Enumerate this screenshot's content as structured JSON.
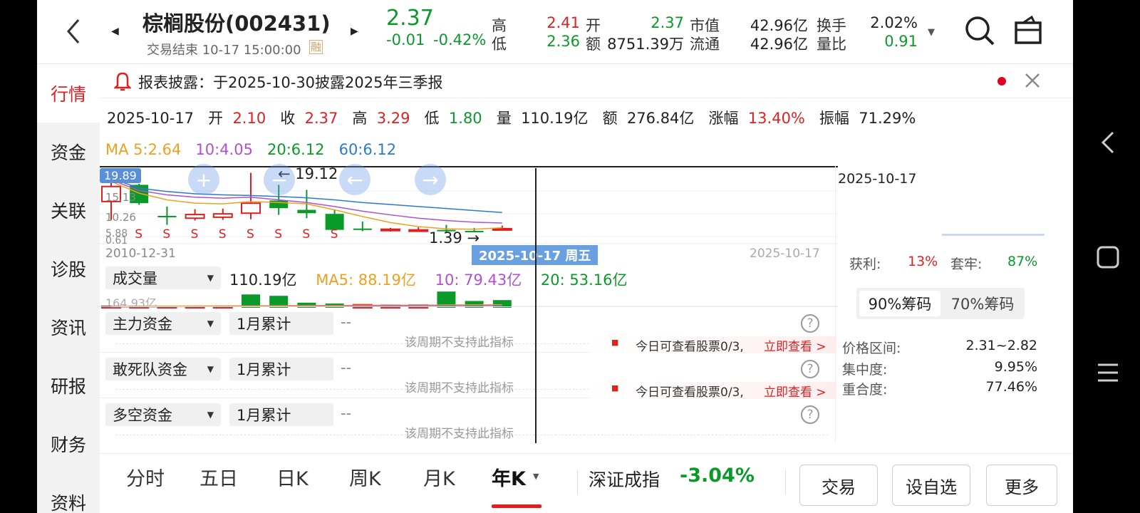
{
  "stock": {
    "name": "棕榈股份(002431)",
    "status": "交易结束 10-17 15:00:00",
    "margin_badge": "融",
    "price": "2.37",
    "change": "-0.01",
    "change_pct": "-0.42%",
    "high_label": "高",
    "high": "2.41",
    "low_label": "低",
    "low": "2.36",
    "open_label": "开",
    "open": "2.37",
    "amount_label": "额",
    "amount": "8751.39万",
    "mktcap_label": "市值",
    "mktcap": "42.96亿",
    "float_label": "流通",
    "float": "42.96亿",
    "turnover_label": "换手",
    "turnover": "2.02%",
    "volratio_label": "量比",
    "volratio": "0.91"
  },
  "nav": {
    "items": [
      "行情",
      "资金",
      "关联",
      "诊股",
      "资讯",
      "研报",
      "财务",
      "资料"
    ],
    "active": 0
  },
  "notice": {
    "text": "报表披露：于2025-10-30披露2025年三季报"
  },
  "ohlc_line": {
    "date": "2025-10-17",
    "open_label": "开",
    "open": "2.10",
    "close_label": "收",
    "close": "2.37",
    "high_label": "高",
    "high": "3.29",
    "low_label": "低",
    "low": "1.80",
    "vol_label": "量",
    "vol": "110.19亿",
    "amt_label": "额",
    "amt": "276.84亿",
    "chg_label": "涨幅",
    "chg": "13.40%",
    "amp_label": "振幅",
    "amp": "71.29%"
  },
  "ma": {
    "ma5": "MA 5:2.64",
    "ma10": "10:4.05",
    "ma20": "20:6.12",
    "ma60": "60:6.12",
    "colors": {
      "ma5": "#f0a020",
      "ma10": "#b050d0",
      "ma20": "#0a9a2a",
      "ma60": "#2a7ad0"
    }
  },
  "kchart": {
    "y_labels": [
      "19.89",
      "15.13",
      "10.26",
      "5.88",
      "0.61"
    ],
    "annot_high": "19.12",
    "annot_low": "1.39",
    "start_date": "2010-12-31",
    "end_date": "2025-10-17",
    "cursor_label": "2025-10-17 周五",
    "dividend_marker": "S",
    "candles": [
      {
        "o": 15.0,
        "c": 10.5,
        "h": 19.89,
        "l": 5.0,
        "dir": "up"
      },
      {
        "o": 15.5,
        "c": 10.0,
        "h": 15.8,
        "l": 9.5,
        "dir": "down"
      },
      {
        "o": 6.2,
        "c": 6.0,
        "h": 9.0,
        "l": 3.5,
        "dir": "down"
      },
      {
        "o": 5.5,
        "c": 6.6,
        "h": 8.2,
        "l": 4.8,
        "dir": "up"
      },
      {
        "o": 5.8,
        "c": 6.8,
        "h": 8.4,
        "l": 5.0,
        "dir": "up"
      },
      {
        "o": 7.0,
        "c": 10.0,
        "h": 19.12,
        "l": 5.2,
        "dir": "up"
      },
      {
        "o": 10.8,
        "c": 8.5,
        "h": 15.5,
        "l": 6.5,
        "dir": "down"
      },
      {
        "o": 8.0,
        "c": 7.0,
        "h": 14.0,
        "l": 5.5,
        "dir": "down"
      },
      {
        "o": 6.8,
        "c": 2.0,
        "h": 8.0,
        "l": 1.8,
        "dir": "down"
      },
      {
        "o": 2.4,
        "c": 2.2,
        "h": 4.5,
        "l": 1.6,
        "dir": "down"
      },
      {
        "o": 1.8,
        "c": 2.2,
        "h": 2.6,
        "l": 1.5,
        "dir": "up"
      },
      {
        "o": 1.8,
        "c": 2.0,
        "h": 2.8,
        "l": 1.39,
        "dir": "up"
      },
      {
        "o": 2.0,
        "c": 1.7,
        "h": 3.5,
        "l": 1.4,
        "dir": "down"
      },
      {
        "o": 1.7,
        "c": 1.6,
        "h": 2.6,
        "l": 1.45,
        "dir": "down"
      },
      {
        "o": 2.1,
        "c": 2.37,
        "h": 3.29,
        "l": 1.8,
        "dir": "up"
      }
    ]
  },
  "chips": {
    "date": "2025-10-17",
    "profit_label": "获利:",
    "profit": "13%",
    "trapped_label": "套牢:",
    "trapped": "87%",
    "tab1": "90%筹码",
    "tab2": "70%筹码",
    "range_label": "价格区间:",
    "range": "2.31~2.82",
    "conc_label": "集中度:",
    "conc": "9.95%",
    "overlap_label": "重合度:",
    "overlap": "77.46%"
  },
  "volume": {
    "selector": "成交量",
    "value": "110.19亿",
    "ma5": "MA5: 88.19亿",
    "ma10": "10: 79.43亿",
    "ma20": "20: 53.16亿",
    "max_label": "164.93亿",
    "bars": [
      2,
      3,
      3,
      4,
      5,
      78,
      70,
      30,
      25,
      18,
      15,
      16,
      95,
      40,
      45,
      67
    ],
    "dirs": [
      "up",
      "up",
      "up",
      "up",
      "up",
      "down",
      "down",
      "down",
      "down",
      "up",
      "up",
      "up",
      "down",
      "down",
      "down",
      "up"
    ]
  },
  "indicators": [
    {
      "name": "主力资金",
      "period": "1月累计",
      "value": "--",
      "msg": "该周期不支持此指标",
      "lock": ""
    },
    {
      "name": "敢死队资金",
      "period": "1月累计",
      "value": "--",
      "msg": "该周期不支持此指标",
      "lock": "今日可查看股票0/3,",
      "lock_link": "立即查看 >"
    },
    {
      "name": "多空资金",
      "period": "1月累计",
      "value": "--",
      "msg": "该周期不支持此指标",
      "lock": "今日可查看股票0/3,",
      "lock_link": "立即查看 >"
    }
  ],
  "tabs": [
    "分时",
    "五日",
    "日K",
    "周K",
    "月K",
    "年K"
  ],
  "active_tab": 5,
  "index": {
    "name": "深证成指",
    "chg": "-3.04%"
  },
  "buttons": {
    "trade": "交易",
    "watch": "设自选",
    "more": "更多"
  }
}
